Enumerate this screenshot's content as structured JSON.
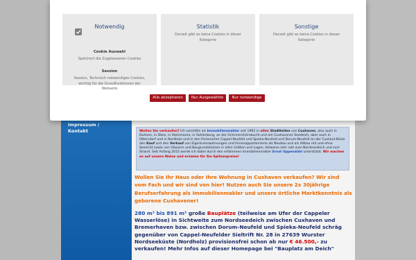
{
  "nav": {
    "impressum": "Impressum /",
    "kontakt": "Kontakt"
  },
  "cookie_modal": {
    "panels": [
      {
        "title": "Notwendig",
        "sub1_h": "Cookie Auswahl",
        "sub1_t": "Speichert die Zugelassenen Cookies",
        "sub2_h": "Session",
        "sub2_t": "Session, Technisch notwendiges Cookies, wichtig für die Grundfunktionen der Webseite"
      },
      {
        "title": "Statistik",
        "desc": "Derzeit gibt es keine Cookies in dieser Kategorie"
      },
      {
        "title": "Sonstige",
        "desc": "Derzeit gibt es keine Cookies in dieser Kategorie"
      }
    ],
    "buttons": {
      "accept_all": "Alle akzeptieren",
      "accept_selected": "Nur Ausgewählte",
      "necessary_only": "Nur notwendige"
    }
  },
  "info_box": {
    "p1": "Wollen Sie verkaufen?",
    "p2": " Ich vermittle als ",
    "p3": "Immobilienmakler",
    "p4": " seit 1992 in ",
    "p5": "allen",
    "p6": " Stadtteilen",
    "p7": " von ",
    "p8": "Cuxhaven",
    "p9": ", also auch in Duhnen, in Döse, in Steinmarne, in Sahlenburg, an der Grimmershörnbucht und am Cuxhavener Seedeich, aber auch in Otterndorf und in Nordholz und in den Ferienorten Cappel-Neufeld und Spieka-Neufeld und Dorum-Neufeld an der Cuxland-Küste den ",
    "p10": "Kauf",
    "p11": " und den ",
    "p12": "Verkauf",
    "p13": " von Eigentumswohnungen und Ferienappartements als Neubau und als Altbau mit und ohne Seesicht sowie von Häusern und Baugrundstücken in allen Größen und Lagen, teilweise sehr nah zum Nordseedeich und zum Strand. Seit Anfang 2015 werde ich dabei durch den erfahrenen Immobilienmakler ",
    "p14": "Ernst Uppendahl",
    "p15": " unterstützt. ",
    "p16": "Wir machen es auf unsere Weise und erzielen für Sie Spitzenpreise!"
  },
  "orange_text": "Wollen Sie Ihr Haus oder Ihre Wohnung in Cuxhaven verkaufen? Wir sind vom Fach und wir sind von hier! Nutzen auch Sie unsere 2x 30jährige Berufserfahrung als Immobilienmakler und unsere örtliche Marktkenntnis als geborene Cuxhavener!",
  "bauplatz": {
    "b1": "280 m² bis 891 m²",
    "b2": " große ",
    "b3": "Bauplätze",
    "b4": " (teilweise am Ufer der Cappeler Wasserlöse) in Sichtweite zum Nordseedeich zwischen Cuxhaven und Bremerhaven bzw. zwischen Dorum-Neufeld und Spieka-Neufeld schräg gegenüber von Cappel-Neufelder Sieltrift Nr. 28 in 27639 Wurster Nordseeküste (Nordholz) provisionsfrei schon ab nur ",
    "b5": "€ 46.500,-",
    "b6": " zu verkaufen! Mehr Infos auf dieser Homepage bei ",
    "b7": "\"Bauplatz am Deich\""
  }
}
